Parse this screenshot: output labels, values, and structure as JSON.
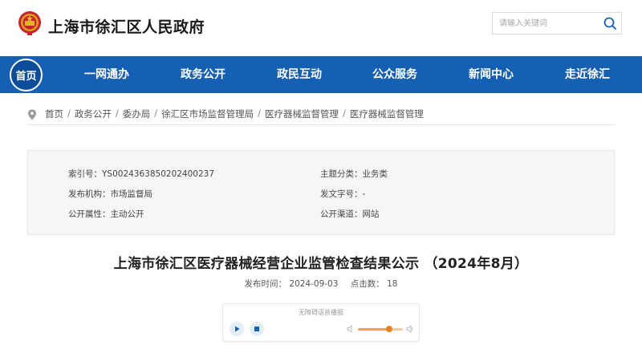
{
  "header": {
    "site_title": "上海市徐汇区人民政府",
    "search_placeholder": "请输入关键词"
  },
  "nav": {
    "home": "首页",
    "items": [
      "一网通办",
      "政务公开",
      "政民互动",
      "公众服务",
      "新闻中心",
      "走近徐汇"
    ]
  },
  "breadcrumb": [
    "首页",
    "政务公开",
    "委办局",
    "徐汇区市场监督管理局",
    "医疗器械监督管理",
    "医疗器械监督管理"
  ],
  "meta": {
    "index_no": "索引号：YS0024363850202400237",
    "category": "主题分类：业务类",
    "publisher": "发布机构：市场监督局",
    "doc_no": "发文字号：-",
    "openness": "公开属性：主动公开",
    "channel": "公开渠道：网站"
  },
  "article": {
    "title": "上海市徐汇区医疗器械经营企业监管检查结果公示 （2024年8月）",
    "publish_time": "发布时间： 2024-09-03",
    "clicks": "点击数： 18"
  },
  "player": {
    "label": "无障碍语音播报",
    "volume": 0.7
  },
  "colors": {
    "nav_bg": "#1660b3",
    "home_bg": "#0b4d99",
    "accent_orange": "#e8821e"
  }
}
